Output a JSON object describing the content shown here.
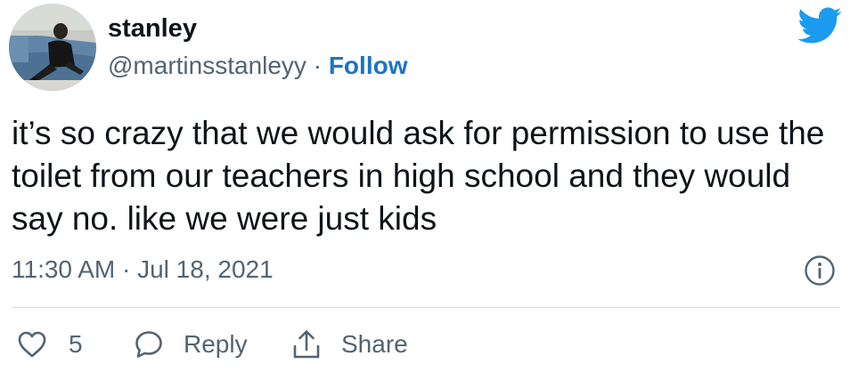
{
  "author": {
    "display_name": "stanley",
    "handle": "@martinsstanleyy",
    "separator": " · ",
    "follow_label": "Follow"
  },
  "tweet": {
    "text": "it’s so crazy that we would ask for permission to use the toilet from our teachers in high school and they would say no. like we were just kids",
    "timestamp": "11:30 AM · Jul 18, 2021"
  },
  "actions": {
    "like_count": "5",
    "reply_label": "Reply",
    "share_label": "Share"
  },
  "icons": {
    "brand": "twitter-bird-icon",
    "info": "info-icon",
    "like": "heart-icon",
    "reply": "speech-bubble-icon",
    "share": "share-arrow-icon"
  },
  "colors": {
    "twitter_blue": "#1d9bf0",
    "follow_blue": "#1b74c5",
    "secondary_text": "#536471",
    "primary_text": "#0f1419",
    "divider": "#cfd9de"
  }
}
